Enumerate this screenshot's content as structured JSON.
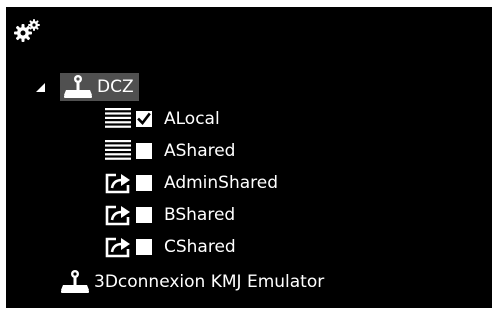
{
  "toolbar": {
    "settings_icon": "gears-icon"
  },
  "tree": {
    "root": {
      "label": "DCZ",
      "expanded": true,
      "selected": true,
      "icon": "joystick-device-icon",
      "children": [
        {
          "label": "ALocal",
          "checked": true,
          "icon": "list-lines-icon"
        },
        {
          "label": "AShared",
          "checked": false,
          "icon": "list-lines-icon"
        },
        {
          "label": "AdminShared",
          "checked": false,
          "icon": "share-arrow-icon"
        },
        {
          "label": "BShared",
          "checked": false,
          "icon": "share-arrow-icon"
        },
        {
          "label": "CShared",
          "checked": false,
          "icon": "share-arrow-icon"
        }
      ]
    },
    "secondary_device": {
      "label": "3Dconnexion KMJ Emulator",
      "icon": "joystick-device-icon"
    }
  },
  "colors": {
    "panel_bg": "#000000",
    "selection_bg": "#505050",
    "text": "#ffffff"
  }
}
